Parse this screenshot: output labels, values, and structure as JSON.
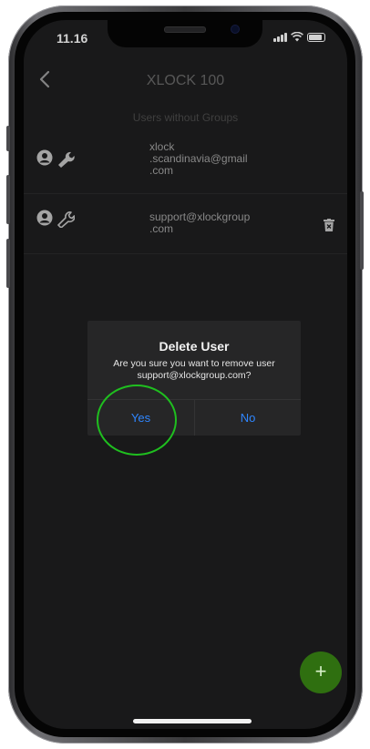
{
  "status_bar": {
    "time": "11.16"
  },
  "header": {
    "title": "XLOCK 100",
    "back_icon": "chevron-left-icon"
  },
  "section": {
    "label": "Users without Groups"
  },
  "users": [
    {
      "email": "xlock\n.scandinavia@gmail\n.com",
      "icons": [
        "person-icon",
        "wrench-icon"
      ],
      "deletable": false
    },
    {
      "email": "support@xlockgroup\n.com",
      "icons": [
        "person-icon",
        "wrench-outline-icon"
      ],
      "deletable": true
    }
  ],
  "dialog": {
    "title": "Delete User",
    "message": "Are you sure you want to remove user support@xlockgroup.com?",
    "yes_label": "Yes",
    "no_label": "No"
  },
  "fab": {
    "label": "+"
  },
  "colors": {
    "accent_blue": "#2f86ff",
    "fab_green": "#2f6f10",
    "highlight_green": "#1fbf1f",
    "background": "#1f1f20"
  }
}
